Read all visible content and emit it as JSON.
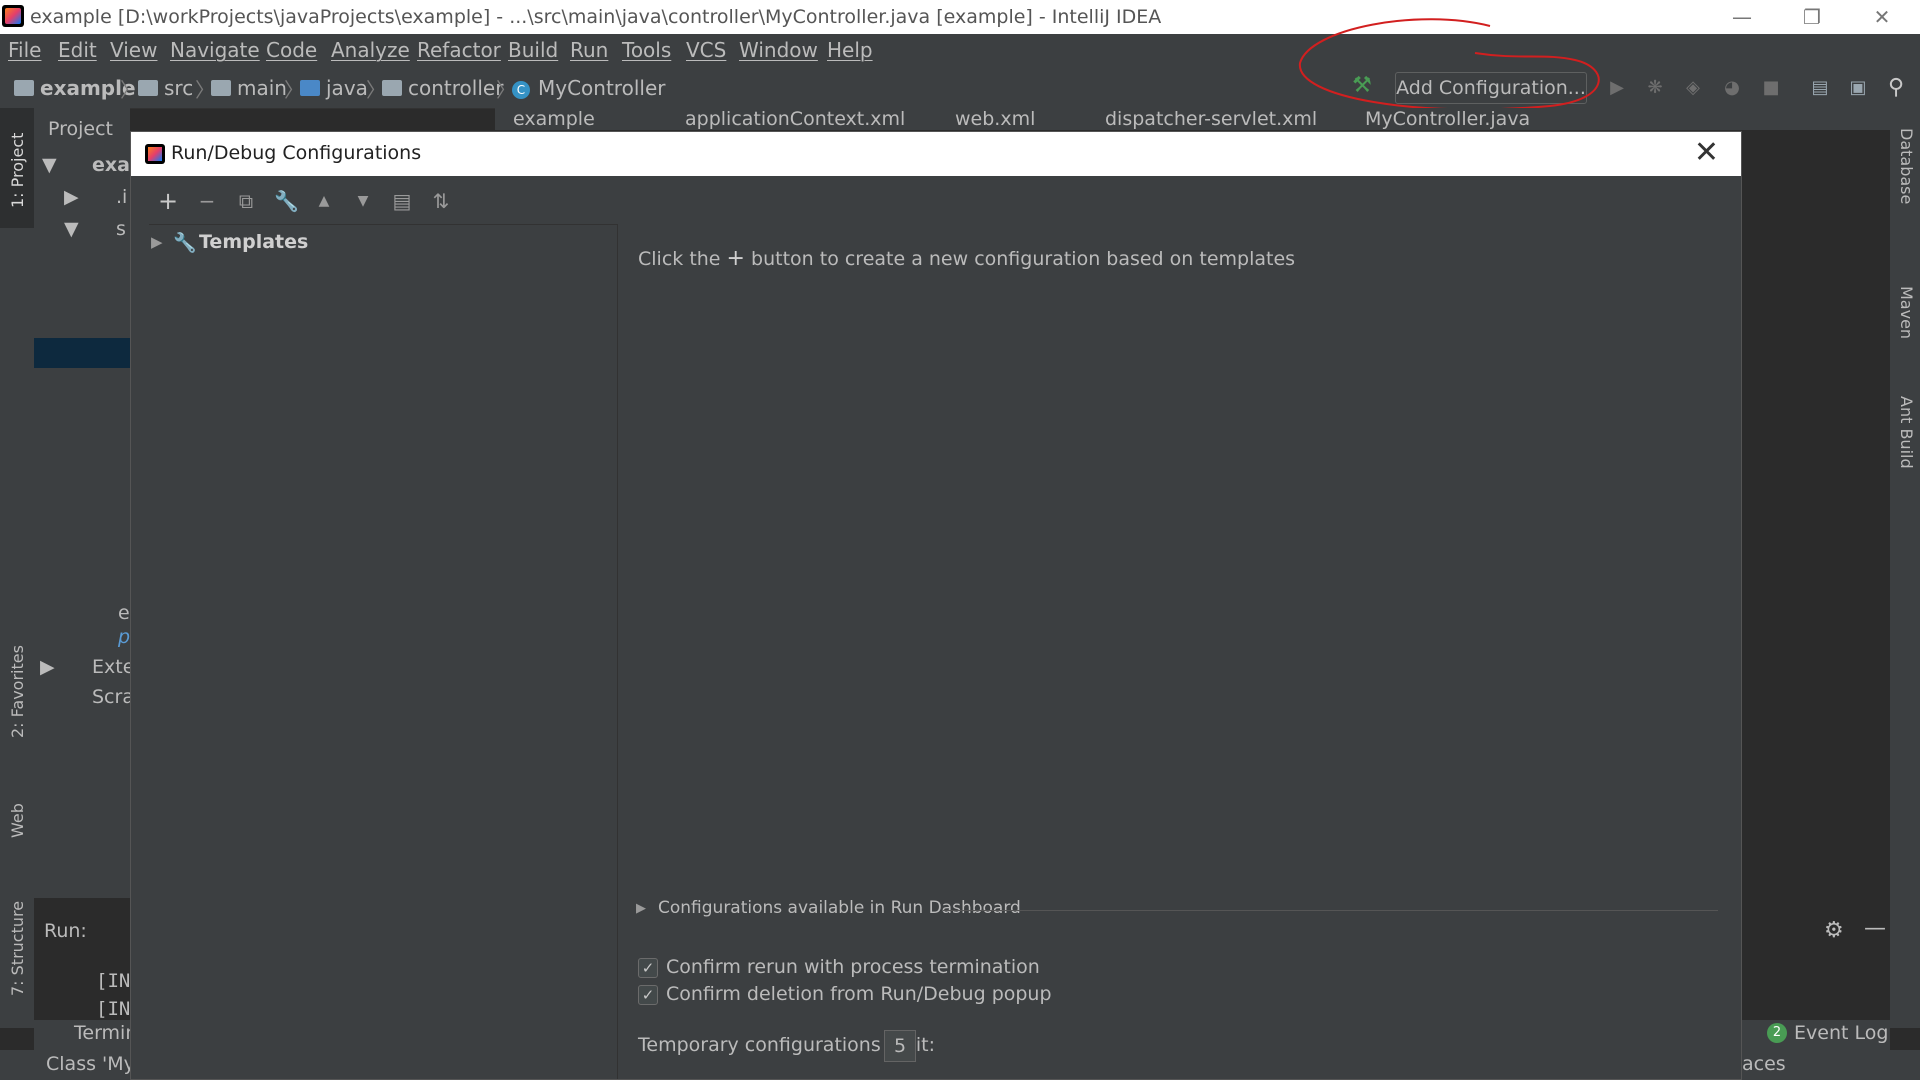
{
  "window": {
    "title": "example [D:\\workProjects\\javaProjects\\example] - ...\\src\\main\\java\\controller\\MyController.java [example] - IntelliJ IDEA"
  },
  "menu": [
    "File",
    "Edit",
    "View",
    "Navigate",
    "Code",
    "Analyze",
    "Refactor",
    "Build",
    "Run",
    "Tools",
    "VCS",
    "Window",
    "Help"
  ],
  "breadcrumb": [
    "example",
    "src",
    "main",
    "java",
    "controller",
    "MyController"
  ],
  "toolbar": {
    "add_configuration": "Add Configuration..."
  },
  "left_stripe": {
    "project": "1: Project",
    "favorites": "2: Favorites",
    "web": "Web",
    "structure": "7: Structure"
  },
  "right_stripe": {
    "database": "Database",
    "maven": "Maven",
    "ant": "Ant Build"
  },
  "project_panel": {
    "header": "Project",
    "rows": [
      "exar",
      ".i",
      "s",
      "e",
      "p",
      "Exte",
      "Scra"
    ]
  },
  "editor_tabs": [
    "example",
    "applicationContext.xml",
    "web.xml",
    "dispatcher-servlet.xml",
    "MyController.java"
  ],
  "run_panel": {
    "label": "Run:",
    "lines": [
      "[IN",
      "[IN"
    ]
  },
  "bottom": {
    "terminal": "Termin",
    "status": "Class 'My",
    "event_log": "Event Log",
    "event_count": "2",
    "spaces": "aces"
  },
  "dialog": {
    "title": "Run/Debug Configurations",
    "tree_root": "Templates",
    "hint_before": "Click the",
    "hint_after": "button to create a new configuration based on templates",
    "dashboard": "Configurations available in Run Dashboard",
    "confirm_rerun": "Confirm rerun with process termination",
    "confirm_deletion": "Confirm deletion from Run/Debug popup",
    "temp_limit_label": "Temporary configurations limit:",
    "temp_limit_value": "5"
  }
}
